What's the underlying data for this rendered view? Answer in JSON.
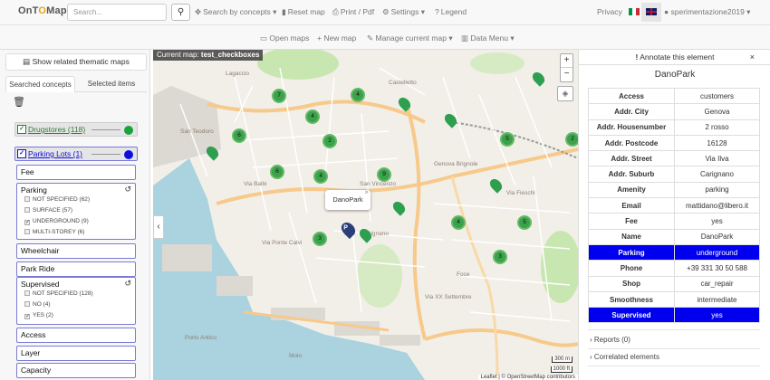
{
  "header": {
    "logo_a": "OnT",
    "logo_o": "O",
    "logo_b": "Map",
    "search_placeholder": "Search...",
    "search_by_concepts": "Search by concepts",
    "reset_map": "Reset map",
    "print_pdf": "Print / Pdf",
    "settings": "Settings",
    "legend": "Legend",
    "privacy": "Privacy",
    "user": "sperimentazione2019"
  },
  "subbar": {
    "open_maps": "Open maps",
    "new_map": "New map",
    "manage_map": "Manage current map",
    "data_menu": "Data Menu"
  },
  "left": {
    "thematic_button": "Show related thematic maps",
    "tabs": [
      "Searched concepts",
      "Selected items"
    ],
    "categories": [
      {
        "label": "Drugstores (118)",
        "color": "#1aa33a"
      },
      {
        "label": "Parking Lots (1)",
        "color": "#0d0de0"
      }
    ],
    "filters": {
      "fee": "Fee",
      "parking_title": "Parking",
      "parking_options": [
        {
          "label": "NOT SPECIFIED (62)",
          "checked": false
        },
        {
          "label": "SURFACE (57)",
          "checked": false
        },
        {
          "label": "UNDERGROUND (9)",
          "checked": true
        },
        {
          "label": "MULTI-STOREY (6)",
          "checked": false
        }
      ],
      "wheelchair": "Wheelchair",
      "park_ride": "Park Ride",
      "supervised_title": "Supervised",
      "supervised_options": [
        {
          "label": "NOT SPECIFIED (128)",
          "checked": false
        },
        {
          "label": "NO (4)",
          "checked": false
        },
        {
          "label": "YES (2)",
          "checked": true
        }
      ],
      "access": "Access",
      "layer": "Layer",
      "capacity": "Capacity"
    }
  },
  "map": {
    "current_label": "Current map:",
    "current_name": "test_checkboxes",
    "zoom_in": "+",
    "zoom_out": "−",
    "popup_name": "DanoPark",
    "scale_m": "300 m",
    "scale_ft": "1000 ft",
    "attribution": "Leaflet | © OpenStreetMap contributors",
    "cluster_counts": [
      "7",
      "4",
      "4",
      "6",
      "2",
      "6",
      "5",
      "4",
      "9",
      "2",
      "3",
      "4",
      "5",
      "3"
    ],
    "street_labels": [
      "San Teodoro",
      "Via Balbi",
      "San Vincenzo",
      "Genova Brignole",
      "Foce",
      "Porto Antico",
      "Carignano",
      "Via Fieschi",
      "Lagaccio",
      "Castelletto",
      "Via Ponte Calvi",
      "Via XX Settembre",
      "Molo"
    ],
    "colors": {
      "water": "#aad3df",
      "land": "#f2efe9",
      "road_major": "#f7c98a",
      "road_minor": "#ffffff",
      "green": "#c8e6b0",
      "cluster": "#3ba24c",
      "pin": "#2e9e4f",
      "parking": "#2a3f7a"
    }
  },
  "right": {
    "annotate": "Annotate this element",
    "title": "DanoPark",
    "rows": [
      {
        "k": "Access",
        "v": "customers",
        "hl": false
      },
      {
        "k": "Addr. City",
        "v": "Genova",
        "hl": false
      },
      {
        "k": "Addr. Housenumber",
        "v": "2 rosso",
        "hl": false
      },
      {
        "k": "Addr. Postcode",
        "v": "16128",
        "hl": false
      },
      {
        "k": "Addr. Street",
        "v": "Via Ilva",
        "hl": false
      },
      {
        "k": "Addr. Suburb",
        "v": "Carignano",
        "hl": false
      },
      {
        "k": "Amenity",
        "v": "parking",
        "hl": false
      },
      {
        "k": "Email",
        "v": "mattidano@libero.it",
        "hl": false
      },
      {
        "k": "Fee",
        "v": "yes",
        "hl": false
      },
      {
        "k": "Name",
        "v": "DanoPark",
        "hl": false
      },
      {
        "k": "Parking",
        "v": "underground",
        "hl": true
      },
      {
        "k": "Phone",
        "v": "+39 331 30 50 588",
        "hl": false
      },
      {
        "k": "Shop",
        "v": "car_repair",
        "hl": false
      },
      {
        "k": "Smoothness",
        "v": "intermediate",
        "hl": false
      },
      {
        "k": "Supervised",
        "v": "yes",
        "hl": true
      }
    ],
    "reports": "Reports (0)",
    "correlated": "Correlated elements"
  }
}
